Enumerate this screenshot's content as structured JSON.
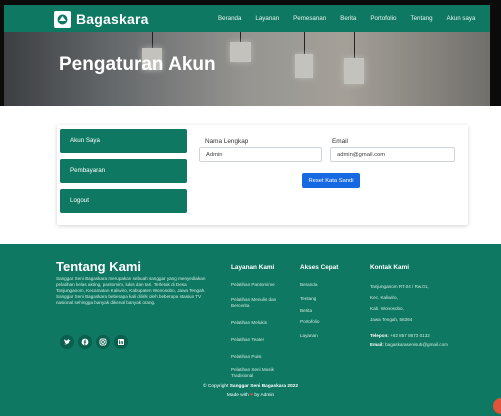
{
  "navbar": {
    "brand": "Bagaskara",
    "links": [
      "Beranda",
      "Layanan",
      "Pemesanan",
      "Berita",
      "Portofolio",
      "Tentang",
      "Akun saya"
    ]
  },
  "hero": {
    "title": "Pengaturan Akun"
  },
  "sidebar": {
    "items": [
      "Akun Saya",
      "Pembayaran",
      "Logout"
    ]
  },
  "form": {
    "name_label": "Nama Lengkap",
    "name_value": "Admin",
    "email_label": "Email",
    "email_value": "admin@gmail.com",
    "reset_button": "Reset Kata Sandi"
  },
  "footer": {
    "about_title": "Tentang Kami",
    "about_text": "Sanggar Seni Bagaskara merupakan sebuah sanggar yang menyediakan pelatihan kelas akting, pantomim, lukis dan tari. Terletak di Desa Tanjunganom, Kecamatan Kaliwiro, Kabupaten Wonosobo, Jawa Tengah. Sanggar Seni Bagaskara beberapa kali dilirik oleh beberapa stasiun TV nasional sehingga banyak dikenal banyak orang.",
    "services_title": "Layanan Kami",
    "services": [
      "Pelatihan Pantomime",
      "Pelatihan Menulis dan Bercerita",
      "Pelatihan Melukis",
      "Pelatihan Teater",
      "Pelatihan Puisi",
      "Pelatihan Seni Musik Tradisional"
    ],
    "quick_title": "Akses Cepat",
    "quick": [
      "Beranda",
      "Tentang",
      "Berita",
      "Portofolio",
      "Layanan"
    ],
    "contact_title": "Kontak Kami",
    "contact_address": [
      "Tanjunganom RT.04 / Rw.01,",
      "Kec. Kaliwiro,",
      "Kab. Wonosobo,",
      "Jawa Tengah, 56364"
    ],
    "phone_label": "Telepon:",
    "phone_value": "+62 857 8673 0132",
    "email_label": "Email:",
    "email_value": "bagaskarasenisub@gmail.com",
    "copyright_prefix": "© Copyright",
    "copyright_name": "Sanggar Seni Bagaskara 2022",
    "made_prefix": "Made with",
    "made_suffix": "by Admin"
  },
  "icons": [
    "logo-icon",
    "twitter-icon",
    "facebook-icon",
    "instagram-icon",
    "linkedin-icon",
    "heart-icon",
    "scroll-top-icon"
  ],
  "colors": {
    "primary": "#0e7862",
    "button": "#1668e3",
    "heart": "#ff4d4d",
    "fab": "#e2533b"
  }
}
